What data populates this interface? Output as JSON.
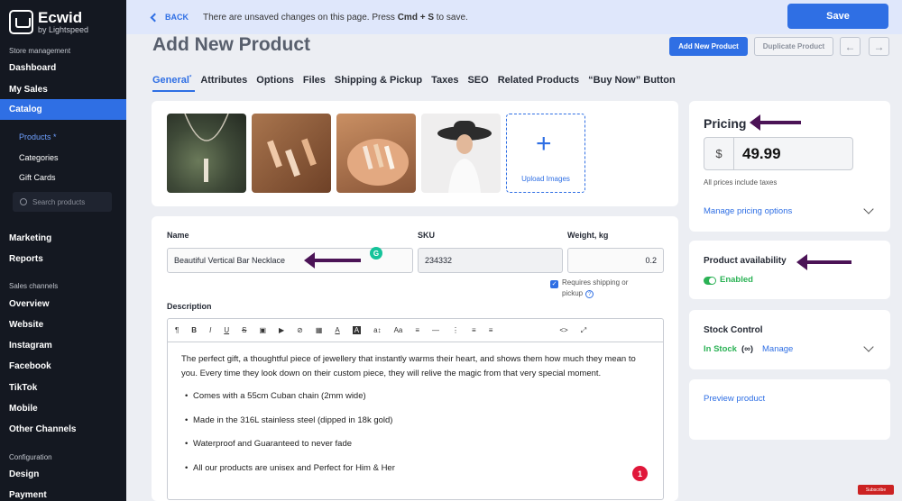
{
  "sidebar": {
    "brand": "Ecwid",
    "brand_sub": "by Lightspeed",
    "section_store": "Store management",
    "dashboard": "Dashboard",
    "my_sales": "My Sales",
    "catalog": "Catalog",
    "products": "Products *",
    "categories": "Categories",
    "gift_cards": "Gift Cards",
    "search_placeholder": "Search products",
    "marketing": "Marketing",
    "reports": "Reports",
    "section_channels": "Sales channels",
    "overview": "Overview",
    "website": "Website",
    "instagram": "Instagram",
    "facebook": "Facebook",
    "tiktok": "TikTok",
    "mobile": "Mobile",
    "other_channels": "Other Channels",
    "section_config": "Configuration",
    "design": "Design",
    "payment": "Payment"
  },
  "topbar": {
    "back": "BACK",
    "unsaved_pre": "There are unsaved changes on this page. Press ",
    "unsaved_keys": "Cmd + S",
    "unsaved_post": " to save.",
    "save": "Save"
  },
  "header": {
    "title": "Add New Product",
    "add_new": "Add New Product",
    "duplicate": "Duplicate Product",
    "prev": "←",
    "next": "→"
  },
  "tabs": [
    "General",
    "Attributes",
    "Options",
    "Files",
    "Shipping & Pickup",
    "Taxes",
    "SEO",
    "Related Products",
    "“Buy Now” Button"
  ],
  "tab_marker": "*",
  "images": {
    "upload_label": "Upload Images",
    "plus": "+"
  },
  "form": {
    "name_label": "Name",
    "name_value": "Beautiful Vertical Bar Necklace",
    "sku_label": "SKU",
    "sku_value": "234332",
    "weight_label": "Weight, kg",
    "weight_value": "0.2",
    "requires_shipping": "Requires shipping or",
    "requires_shipping_2": "pickup",
    "description_label": "Description",
    "grammarly": "G"
  },
  "editor": {
    "toolbar": [
      "¶",
      "B",
      "I",
      "U",
      "S",
      "▣",
      "▶",
      "⊘",
      "▦",
      "A",
      "A",
      "a↕",
      "Aa",
      "≡",
      "—",
      "⋮",
      "≡",
      "≡",
      "<>",
      "⤢"
    ],
    "paragraph": "The perfect gift, a thoughtful piece of jewellery that instantly warms their heart, and shows them how much they mean to you. Every time they look down on their custom piece, they will relive the magic from that very special moment.",
    "bullets": [
      "Comes with a 55cm Cuban chain (2mm wide)",
      "Made in the 316L stainless steel (dipped in 18k gold)",
      "Waterproof and Guaranteed to never fade",
      "All our products are unisex and Perfect for Him & Her"
    ],
    "badge": "1"
  },
  "pricing": {
    "title": "Pricing",
    "currency": "$",
    "price": "49.99",
    "note": "All prices include taxes",
    "manage": "Manage pricing options"
  },
  "availability": {
    "title": "Product availability",
    "status": "Enabled"
  },
  "stock": {
    "title": "Stock Control",
    "status": "In Stock",
    "infinity": "(∞)",
    "manage": "Manage"
  },
  "preview": {
    "label": "Preview product"
  },
  "watermark": "Subscribe",
  "colors": {
    "accent": "#2f6fe4",
    "sidebar_bg": "#141821",
    "arrow": "#4b1356",
    "success": "#2bb255"
  }
}
